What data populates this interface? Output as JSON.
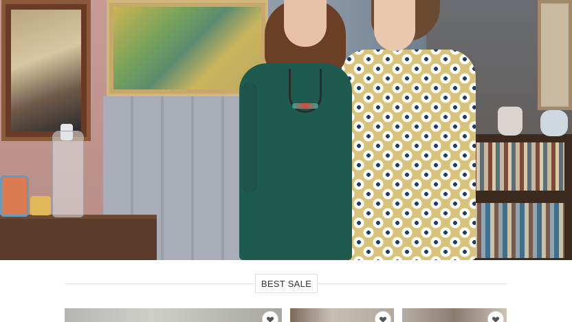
{
  "section": {
    "title": "BEST SALE"
  },
  "products": [
    {
      "icon": "heart-icon"
    },
    {
      "icon": "heart-icon"
    },
    {
      "icon": "heart-icon"
    }
  ],
  "colors": {
    "accent_dress_green": "#1f5a4e",
    "dress_floral_base": "#d9c27a",
    "divider": "#e2e2e2",
    "badge_border": "#dedede"
  }
}
